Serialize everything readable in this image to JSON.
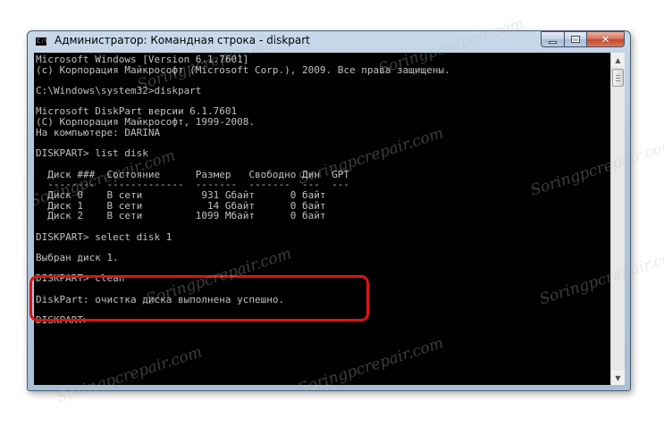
{
  "window": {
    "title": "Администратор: Командная строка - diskpart",
    "icon_label": "C:\\"
  },
  "caption_buttons": {
    "minimize_icon": "minimize-icon",
    "maximize_icon": "maximize-icon",
    "close_icon": "close-icon",
    "close_glyph": "✕"
  },
  "console": {
    "lines": [
      "Microsoft Windows [Version 6.1.7601]",
      "(c) Корпорация Майкрософт (Microsoft Corp.), 2009. Все права защищены.",
      "",
      "C:\\Windows\\system32>diskpart",
      "",
      "Microsoft DiskPart версии 6.1.7601",
      "(C) Корпорация Майкрософт, 1999-2008.",
      "На компьютере: DARINA",
      "",
      "DISKPART> list disk",
      "",
      "  Диск ###  Состояние      Размер   Свободно Дин  GPT",
      "  --------  -------------  -------  -------  ---  ---",
      "  Диск 0    В сети          931 Gбайт      0 байт",
      "  Диск 1    В сети           14 Gбайт      0 байт",
      "  Диск 2    В сети         1099 Мбайт      0 байт",
      "",
      "DISKPART> select disk 1",
      "",
      "Выбран диск 1.",
      "",
      "DISKPART> clean",
      "",
      "DiskPart: очистка диска выполнена успешно.",
      "",
      "DISKPART>"
    ],
    "colors": {
      "background": "#000000",
      "text": "#c0c0c0",
      "highlight": "#e01212"
    }
  },
  "scrollbar": {
    "up_glyph": "▲",
    "down_glyph": "▼"
  },
  "watermark": {
    "text": "Soringpcrepair.com"
  }
}
